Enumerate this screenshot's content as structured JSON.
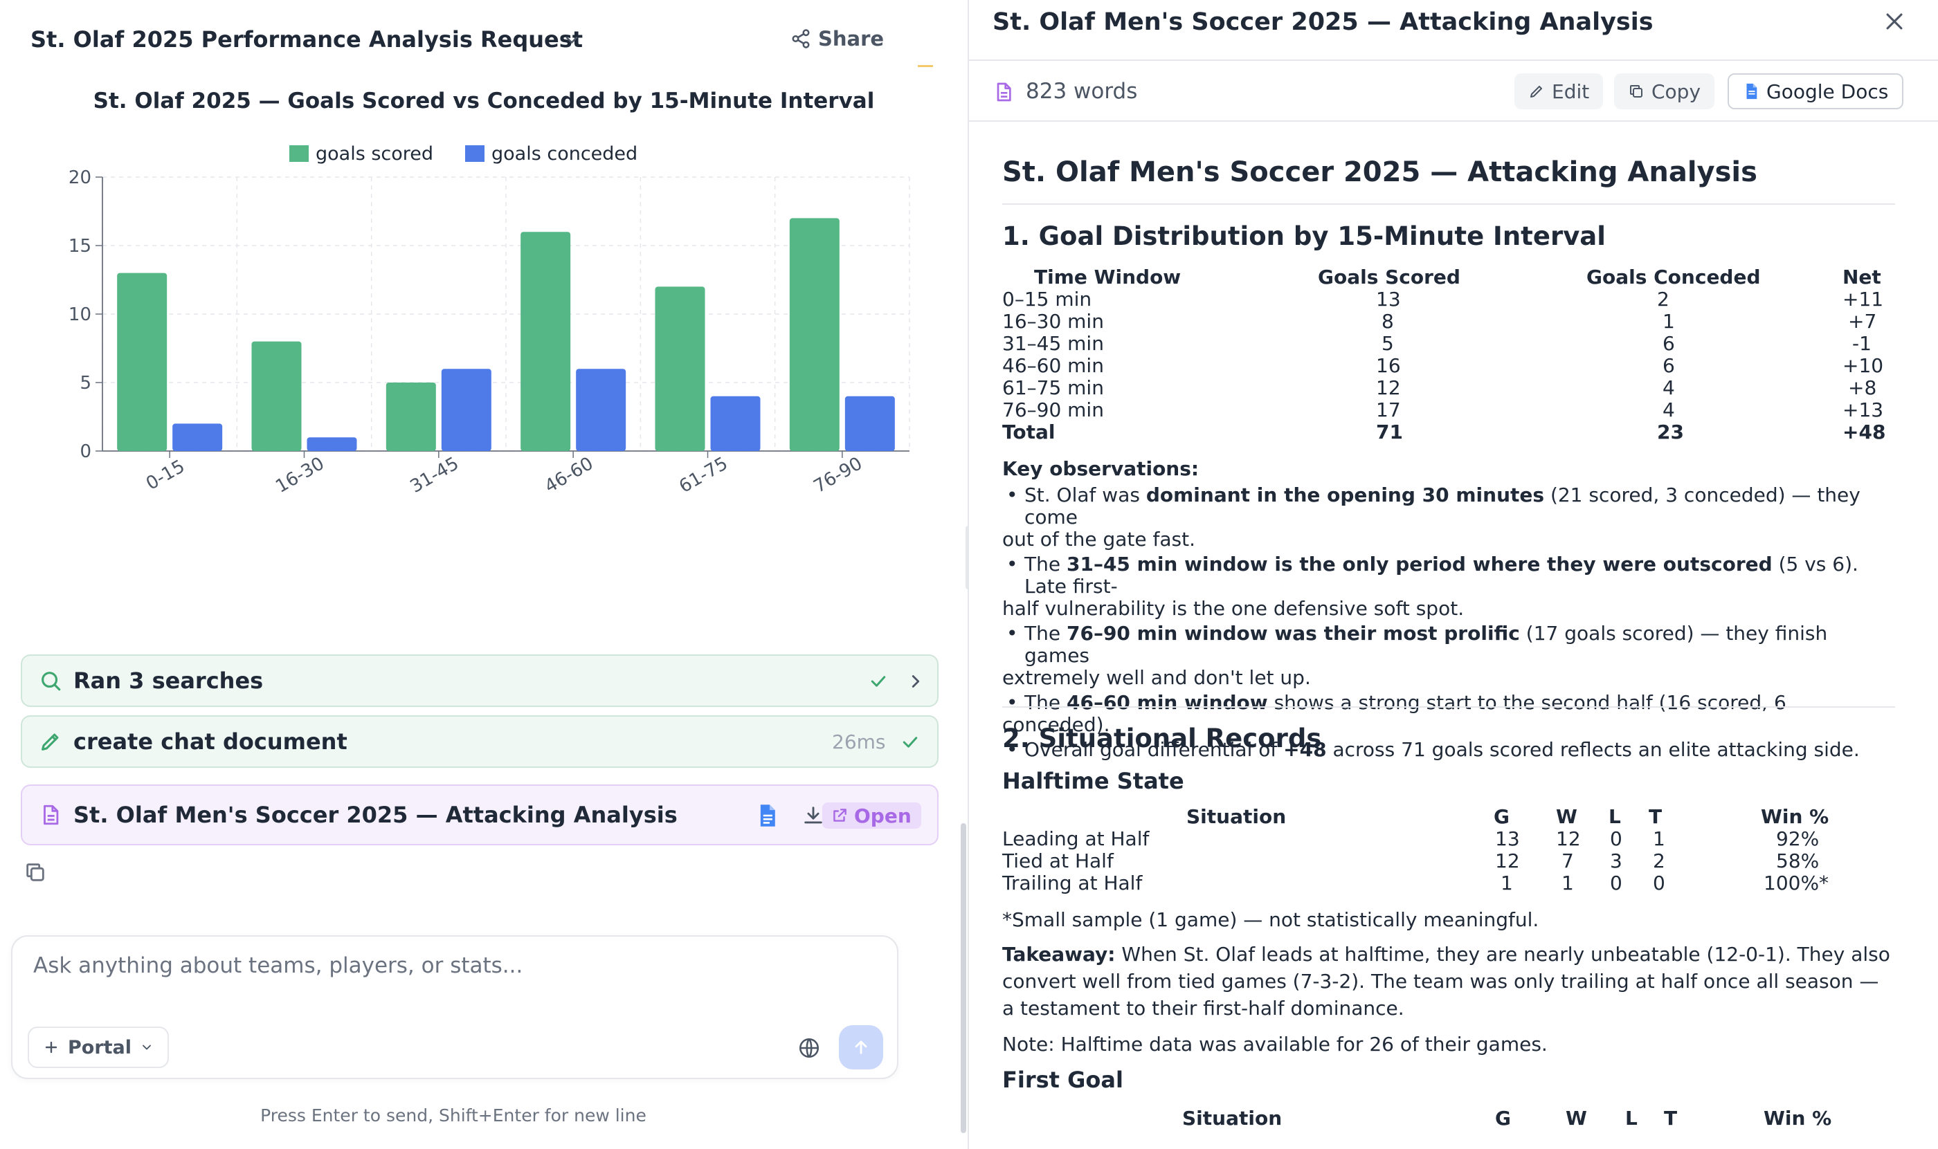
{
  "chat": {
    "title": "St. Olaf 2025 Performance Analysis Request",
    "share_label": "Share",
    "chart_title": "St. Olaf 2025 — Goals Scored vs Conceded by 15-Minute Interval",
    "tools": {
      "search_label": "Ran 3 searches",
      "create_label": "create chat document",
      "create_time": "26ms",
      "doc_label": "St. Olaf Men's Soccer 2025 — Attacking Analysis",
      "open_label": "Open"
    },
    "composer": {
      "placeholder": "Ask anything about teams, players, or stats...",
      "portal_label": "Portal"
    },
    "hint": "Press Enter to send, Shift+Enter for new line"
  },
  "chart_data": {
    "type": "bar",
    "title": "St. Olaf 2025 — Goals Scored vs Conceded by 15-Minute Interval",
    "categories": [
      "0-15",
      "16-30",
      "31-45",
      "46-60",
      "61-75",
      "76-90"
    ],
    "series": [
      {
        "name": "goals scored",
        "values": [
          13,
          8,
          5,
          16,
          12,
          17
        ],
        "color": "#55b786"
      },
      {
        "name": "goals conceded",
        "values": [
          2,
          1,
          6,
          6,
          4,
          4
        ],
        "color": "#4f7be8"
      }
    ],
    "ylim": [
      0,
      20
    ],
    "yticks": [
      0,
      5,
      10,
      15,
      20
    ],
    "grid": true,
    "legend_position": "top-center",
    "xlabel": "",
    "ylabel": ""
  },
  "doc": {
    "header_title": "St. Olaf Men's Soccer 2025 — Attacking Analysis",
    "word_count": "823 words",
    "edit_label": "Edit",
    "copy_label": "Copy",
    "gdocs_label": "Google Docs",
    "h1": "St. Olaf Men's Soccer 2025 — Attacking Analysis",
    "sec1_title": "1. Goal Distribution by 15-Minute Interval",
    "goal_table": {
      "headers": [
        "Time Window",
        "Goals Scored",
        "Goals Conceded",
        "Net"
      ],
      "rows": [
        [
          "0–15 min",
          "13",
          "2",
          "+11"
        ],
        [
          "16–30 min",
          "8",
          "1",
          "+7"
        ],
        [
          "31–45 min",
          "5",
          "6",
          "-1"
        ],
        [
          "46–60 min",
          "16",
          "6",
          "+10"
        ],
        [
          "61–75 min",
          "12",
          "4",
          "+8"
        ],
        [
          "76–90 min",
          "17",
          "4",
          "+13"
        ]
      ],
      "total": [
        "Total",
        "71",
        "23",
        "+48"
      ]
    },
    "key_obs_label": "Key observations:",
    "observations": [
      {
        "a": "St. Olaf was ",
        "b": "dominant in the opening 30 minutes",
        "c": " (21 scored, 3 conceded) — they come",
        "d": "out of the gate fast."
      },
      {
        "a": "The ",
        "b": "31–45 min window is the only period where they were outscored",
        "c": " (5 vs 6). Late first-",
        "d": "half vulnerability is the one defensive soft spot."
      },
      {
        "a": "The ",
        "b": "76–90 min window was their most prolific",
        "c": " (17 goals scored) — they finish games",
        "d": "extremely well and don't let up."
      },
      {
        "a": "The ",
        "b": "46–60 min window",
        "c": " shows a strong start to the second half (16 scored, 6",
        "d": "conceded)."
      },
      {
        "a": "Overall goal differential of ",
        "b": "+48",
        "c": " across 71 goals scored reflects an elite attacking side.",
        "d": ""
      }
    ],
    "sec2_title": "2. Situational Records",
    "halftime_title": "Halftime State",
    "halftime_table": {
      "headers": [
        "Situation",
        "G",
        "W",
        "L",
        "T",
        "Win %"
      ],
      "rows": [
        [
          "Leading at Half",
          "13",
          "12",
          "0",
          "1",
          "92%"
        ],
        [
          "Tied at Half",
          "12",
          "7",
          "3",
          "2",
          "58%"
        ],
        [
          "Trailing at Half",
          "1",
          "1",
          "0",
          "0",
          "100%*"
        ]
      ]
    },
    "small_sample_note": "*Small sample (1 game) — not statistically meaningful.",
    "takeaway_label": "Takeaway:",
    "takeaway_text": " When St. Olaf leads at halftime, they are nearly unbeatable (12-0-1). They also convert well from tied games (7-3-2). The team was only trailing at half once all season — a testament to their first-half dominance.",
    "halftime_note": "Note: Halftime data was available for 26 of their games.",
    "first_goal_title": "First Goal",
    "first_goal_headers": [
      "Situation",
      "G",
      "W",
      "L",
      "T",
      "Win %"
    ]
  }
}
